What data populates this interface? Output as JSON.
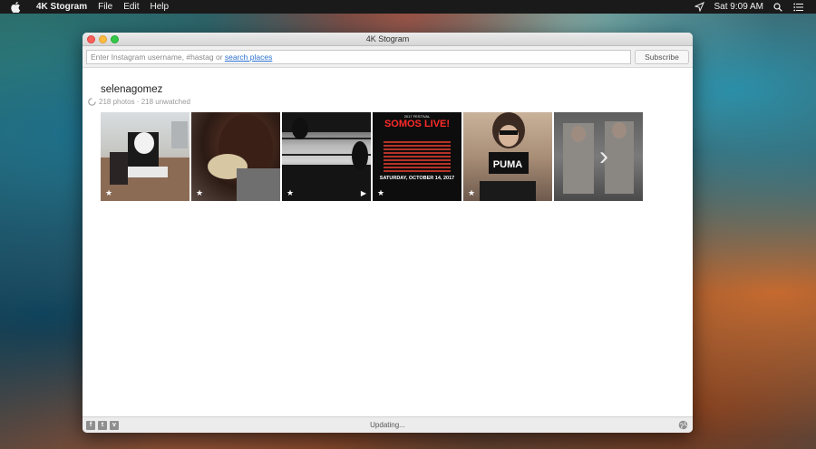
{
  "menubar": {
    "app_name": "4K Stogram",
    "items": [
      "File",
      "Edit",
      "Help"
    ],
    "clock": "Sat 9:09 AM"
  },
  "window": {
    "title": "4K Stogram",
    "search": {
      "placeholder": "Enter Instagram username, #hastag or ",
      "link": "search places"
    },
    "subscribe_label": "Subscribe",
    "account": {
      "name": "selenagomez",
      "stats": "218 photos · 218 unwatched"
    },
    "thumbnails": [
      {
        "label": "photo-1",
        "starred": true,
        "video": false
      },
      {
        "label": "photo-2",
        "starred": true,
        "video": false
      },
      {
        "label": "photo-3",
        "starred": true,
        "video": true
      },
      {
        "label": "photo-4",
        "starred": true,
        "video": false,
        "poster": {
          "top": "2017 FESTIVAL",
          "logo": "SOMOS LIVE!",
          "date": "SATURDAY, OCTOBER 14, 2017"
        }
      },
      {
        "label": "photo-5",
        "starred": true,
        "video": false,
        "brand": "PUMA"
      },
      {
        "label": "photo-6",
        "starred": false,
        "video": false
      }
    ],
    "status": "Updating...",
    "social": [
      "f",
      "t",
      "v"
    ],
    "colors": {
      "link": "#2a6fd0",
      "poster_red": "#ff2a2a"
    }
  }
}
